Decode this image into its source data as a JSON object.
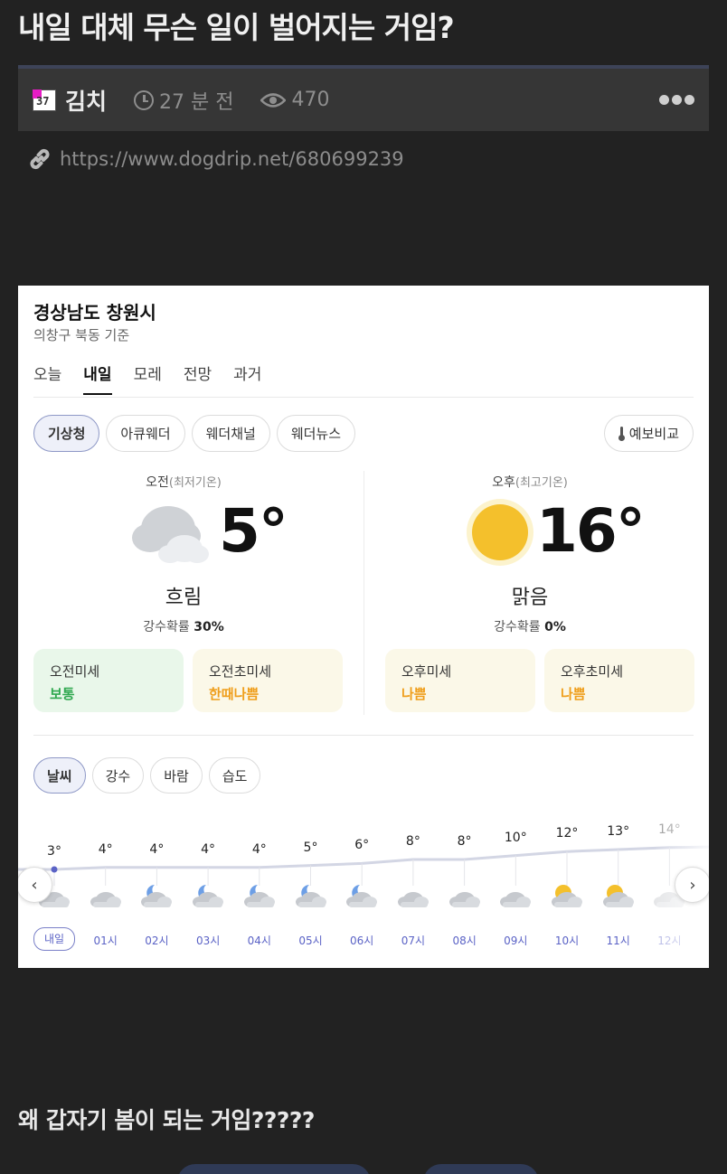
{
  "post": {
    "title": "내일 대체 무슨 일이 벌어지는 거임?",
    "author_badge": "37",
    "author": "김치",
    "time_ago": "27 분 전",
    "views": "470",
    "url": "https://www.dogdrip.net/680699239",
    "body": "왜 갑자기 봄이 되는 거임?????"
  },
  "weather": {
    "location": "경상남도 창원시",
    "location_sub": "의창구 북동 기준",
    "day_tabs": [
      "오늘",
      "내일",
      "모레",
      "전망",
      "과거"
    ],
    "active_day_tab": "내일",
    "sources": [
      "기상청",
      "아큐웨더",
      "웨더채널",
      "웨더뉴스"
    ],
    "active_source": "기상청",
    "compare_label": "예보비교",
    "am": {
      "label": "오전",
      "label_sub": "(최저기온)",
      "temp": "5°",
      "condition": "흐림",
      "precip_label": "강수확률",
      "precip_value": "30%",
      "dust": [
        {
          "label": "오전미세",
          "value": "보통",
          "level": "good"
        },
        {
          "label": "오전초미세",
          "value": "한때나쁨",
          "level": "bad"
        }
      ]
    },
    "pm": {
      "label": "오후",
      "label_sub": "(최고기온)",
      "temp": "16°",
      "condition": "맑음",
      "precip_label": "강수확률",
      "precip_value": "0%",
      "dust": [
        {
          "label": "오후미세",
          "value": "나쁨",
          "level": "bad"
        },
        {
          "label": "오후초미세",
          "value": "나쁨",
          "level": "bad"
        }
      ]
    },
    "metric_tabs": [
      "날씨",
      "강수",
      "바람",
      "습도"
    ],
    "active_metric": "날씨",
    "hourly": [
      {
        "time": "내일",
        "temp": 3,
        "temp_label": "3°",
        "icon": "cloud-moon-icon"
      },
      {
        "time": "01시",
        "temp": 4,
        "temp_label": "4°",
        "icon": "cloud-icon"
      },
      {
        "time": "02시",
        "temp": 4,
        "temp_label": "4°",
        "icon": "cloud-moon-icon"
      },
      {
        "time": "03시",
        "temp": 4,
        "temp_label": "4°",
        "icon": "cloud-moon-icon"
      },
      {
        "time": "04시",
        "temp": 4,
        "temp_label": "4°",
        "icon": "cloud-moon-icon"
      },
      {
        "time": "05시",
        "temp": 5,
        "temp_label": "5°",
        "icon": "cloud-moon-icon"
      },
      {
        "time": "06시",
        "temp": 6,
        "temp_label": "6°",
        "icon": "cloud-moon-icon"
      },
      {
        "time": "07시",
        "temp": 8,
        "temp_label": "8°",
        "icon": "cloud-icon"
      },
      {
        "time": "08시",
        "temp": 8,
        "temp_label": "8°",
        "icon": "cloud-icon"
      },
      {
        "time": "09시",
        "temp": 10,
        "temp_label": "10°",
        "icon": "cloud-icon"
      },
      {
        "time": "10시",
        "temp": 12,
        "temp_label": "12°",
        "icon": "cloud-sun-icon"
      },
      {
        "time": "11시",
        "temp": 13,
        "temp_label": "13°",
        "icon": "cloud-sun-icon"
      },
      {
        "time": "12시",
        "temp": 14,
        "temp_label": "14°",
        "icon": "cloud-icon"
      }
    ]
  }
}
